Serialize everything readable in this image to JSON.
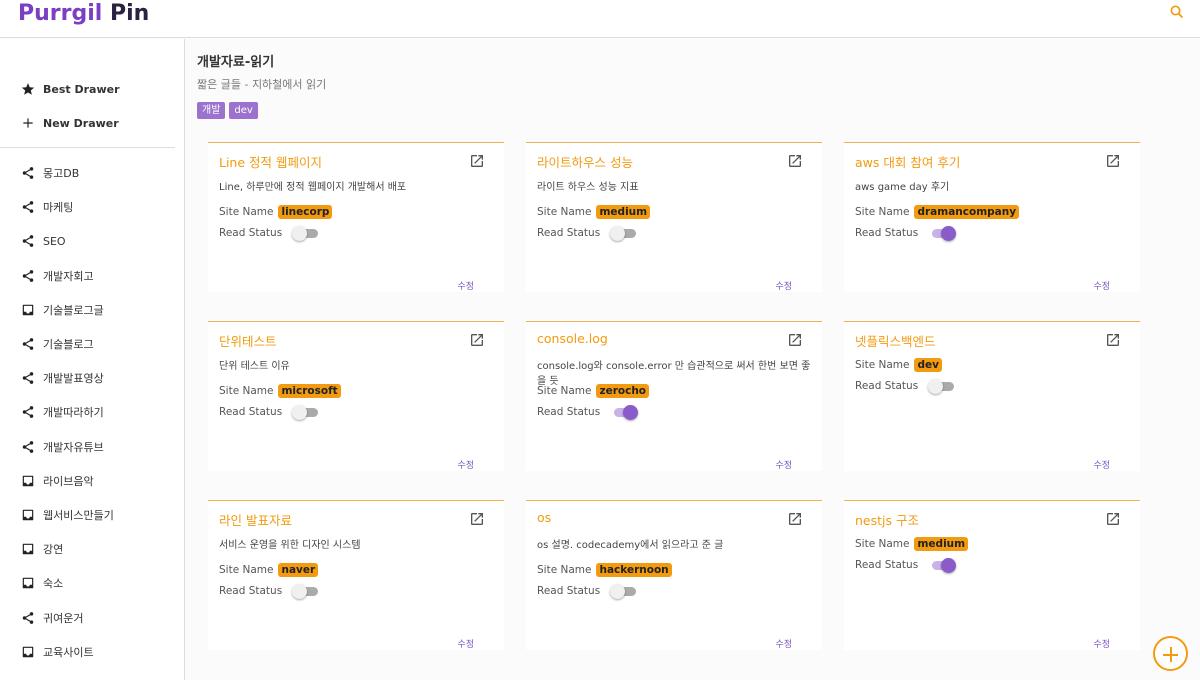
{
  "app": {
    "logo_part1": "Purrgil",
    "logo_part2": "Pin"
  },
  "sidebar": {
    "top_items": [
      {
        "label": "Best Drawer",
        "icon": "star-icon"
      },
      {
        "label": "New Drawer",
        "icon": "plus-icon"
      }
    ],
    "drawers": [
      {
        "label": "몽고DB",
        "icon": "share-icon"
      },
      {
        "label": "마케팅",
        "icon": "share-icon"
      },
      {
        "label": "SEO",
        "icon": "share-icon"
      },
      {
        "label": "개발자회고",
        "icon": "share-icon"
      },
      {
        "label": "기술블로그글",
        "icon": "inbox-icon"
      },
      {
        "label": "기술블로그",
        "icon": "share-icon"
      },
      {
        "label": "개발발표영상",
        "icon": "share-icon"
      },
      {
        "label": "개발따라하기",
        "icon": "share-icon"
      },
      {
        "label": "개발자유튜브",
        "icon": "share-icon"
      },
      {
        "label": "라이브음악",
        "icon": "inbox-icon"
      },
      {
        "label": "웹서비스만들기",
        "icon": "inbox-icon"
      },
      {
        "label": "강연",
        "icon": "inbox-icon"
      },
      {
        "label": "숙소",
        "icon": "inbox-icon"
      },
      {
        "label": "귀여운거",
        "icon": "share-icon"
      },
      {
        "label": "교육사이트",
        "icon": "inbox-icon"
      }
    ]
  },
  "drawer": {
    "title": "개발자료-읽기",
    "description": "짧은 글들 - 지하철에서 읽기",
    "tags": [
      "개발",
      "dev"
    ]
  },
  "labels": {
    "site_name": "Site Name",
    "read_status": "Read Status",
    "edit": "수정"
  },
  "cards": [
    {
      "title": "Line 정적 웹페이지",
      "desc": "Line, 하루만에 정적 웹페이지 개발해서 배포",
      "site": "linecorp",
      "read": false
    },
    {
      "title": "라이트하우스 성능",
      "desc": "라이트 하우스 성능 지표",
      "site": "medium",
      "read": false
    },
    {
      "title": "aws 대회 참여 후기",
      "desc": "aws game day 후기",
      "site": "dramancompany",
      "read": true
    },
    {
      "title": "단위테스트",
      "desc": "단위 테스트 이유",
      "site": "microsoft",
      "read": false
    },
    {
      "title": "console.log",
      "desc": "console.log와 console.error 만 습관적으로 써서 한번 보면 좋을 듯",
      "site": "zerocho",
      "read": true
    },
    {
      "title": "넷플릭스백엔드",
      "desc": "",
      "site": "dev",
      "read": false
    },
    {
      "title": "라인 발표자료",
      "desc": "서비스 운영을 위한 디자인 시스템",
      "site": "naver",
      "read": false
    },
    {
      "title": "os",
      "desc": "os 설명. codecademy에서 읽으라고 준 글",
      "site": "hackernoon",
      "read": false
    },
    {
      "title": "nestjs 구조",
      "desc": "",
      "site": "medium",
      "read": true
    }
  ],
  "colors": {
    "accent": "#f29b10",
    "brand": "#7a3fc2",
    "tag": "#9b73cf"
  }
}
